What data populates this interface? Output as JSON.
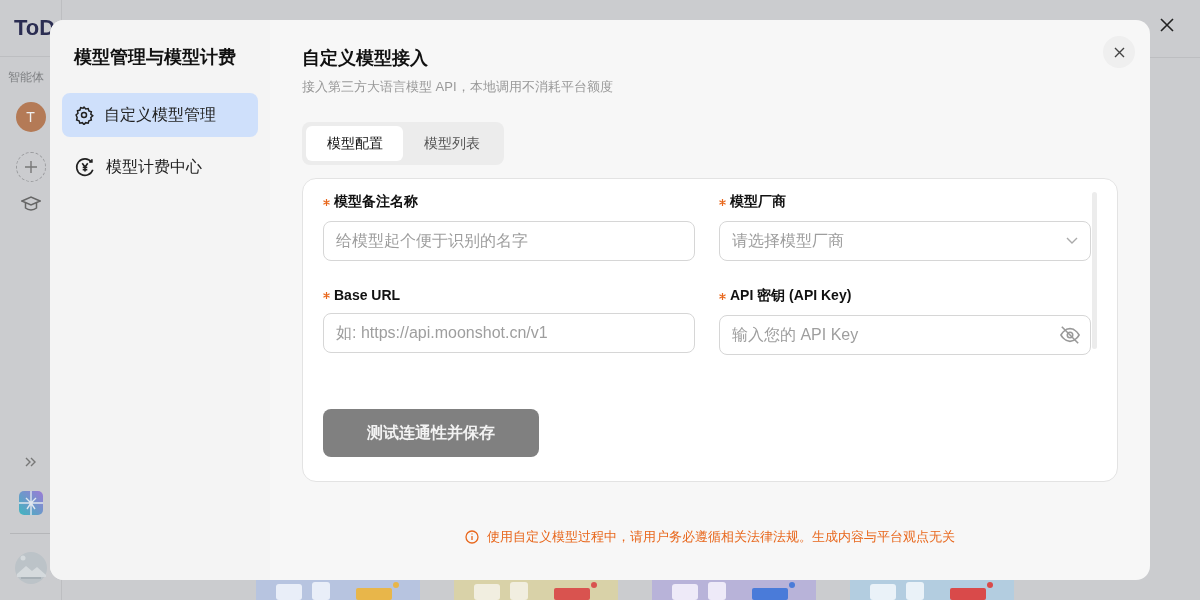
{
  "app": {
    "logo": "ToD",
    "section_label": "智能体",
    "avatar": "T"
  },
  "dialog": {
    "title": "模型管理与模型计费",
    "nav": [
      {
        "label": "自定义模型管理",
        "kind": "gear",
        "selected": true
      },
      {
        "label": "模型计费中心",
        "kind": "yen",
        "selected": false
      }
    ],
    "heading": "自定义模型接入",
    "subtitle": "接入第三方大语言模型 API，本地调用不消耗平台额度",
    "tabs": [
      {
        "label": "模型配置",
        "selected": true
      },
      {
        "label": "模型列表",
        "selected": false
      }
    ],
    "fields": [
      {
        "label": "模型备注名称",
        "required": true,
        "kind": "text",
        "placeholder": "给模型起个便于识别的名字"
      },
      {
        "label": "模型厂商",
        "required": true,
        "kind": "select",
        "placeholder": "请选择模型厂商"
      },
      {
        "label": "Base URL",
        "required": true,
        "kind": "text",
        "placeholder": "如: https://api.moonshot.cn/v1"
      },
      {
        "label": "API 密钥 (API Key)",
        "required": true,
        "kind": "password",
        "placeholder": "输入您的 API Key"
      }
    ],
    "submit": {
      "label": "测试连通性并保存",
      "disabled": true
    },
    "notice": "使用自定义模型过程中，请用户务必遵循相关法律法规。生成内容与平台观点无关"
  }
}
